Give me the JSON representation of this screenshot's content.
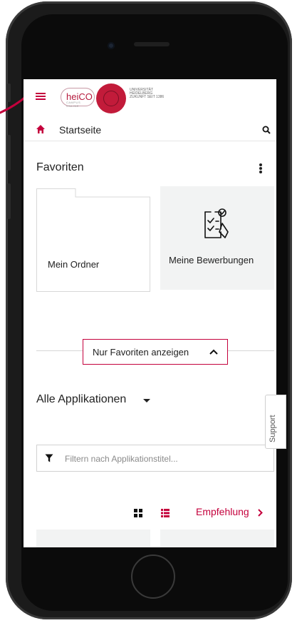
{
  "header": {
    "logo_text": "heiCO",
    "logo_sub": "CAMPUS ONLINE",
    "university_text": "UNIVERSITÄT HEIDELBERG ZUKUNFT SEIT 1386"
  },
  "navbar": {
    "title": "Startseite"
  },
  "favorites": {
    "title": "Favoriten",
    "tiles": [
      {
        "label": "Mein Ordner"
      },
      {
        "label": "Meine Bewerbungen"
      }
    ],
    "toggle_label": "Nur Favoriten anzeigen"
  },
  "apps": {
    "title": "Alle Applikationen",
    "filter_placeholder": "Filtern nach Applikationstitel...",
    "recommend_label": "Empfehlung"
  },
  "support": {
    "label": "Support"
  },
  "colors": {
    "accent": "#c4003c",
    "tile_bg": "#f2f3f3"
  }
}
